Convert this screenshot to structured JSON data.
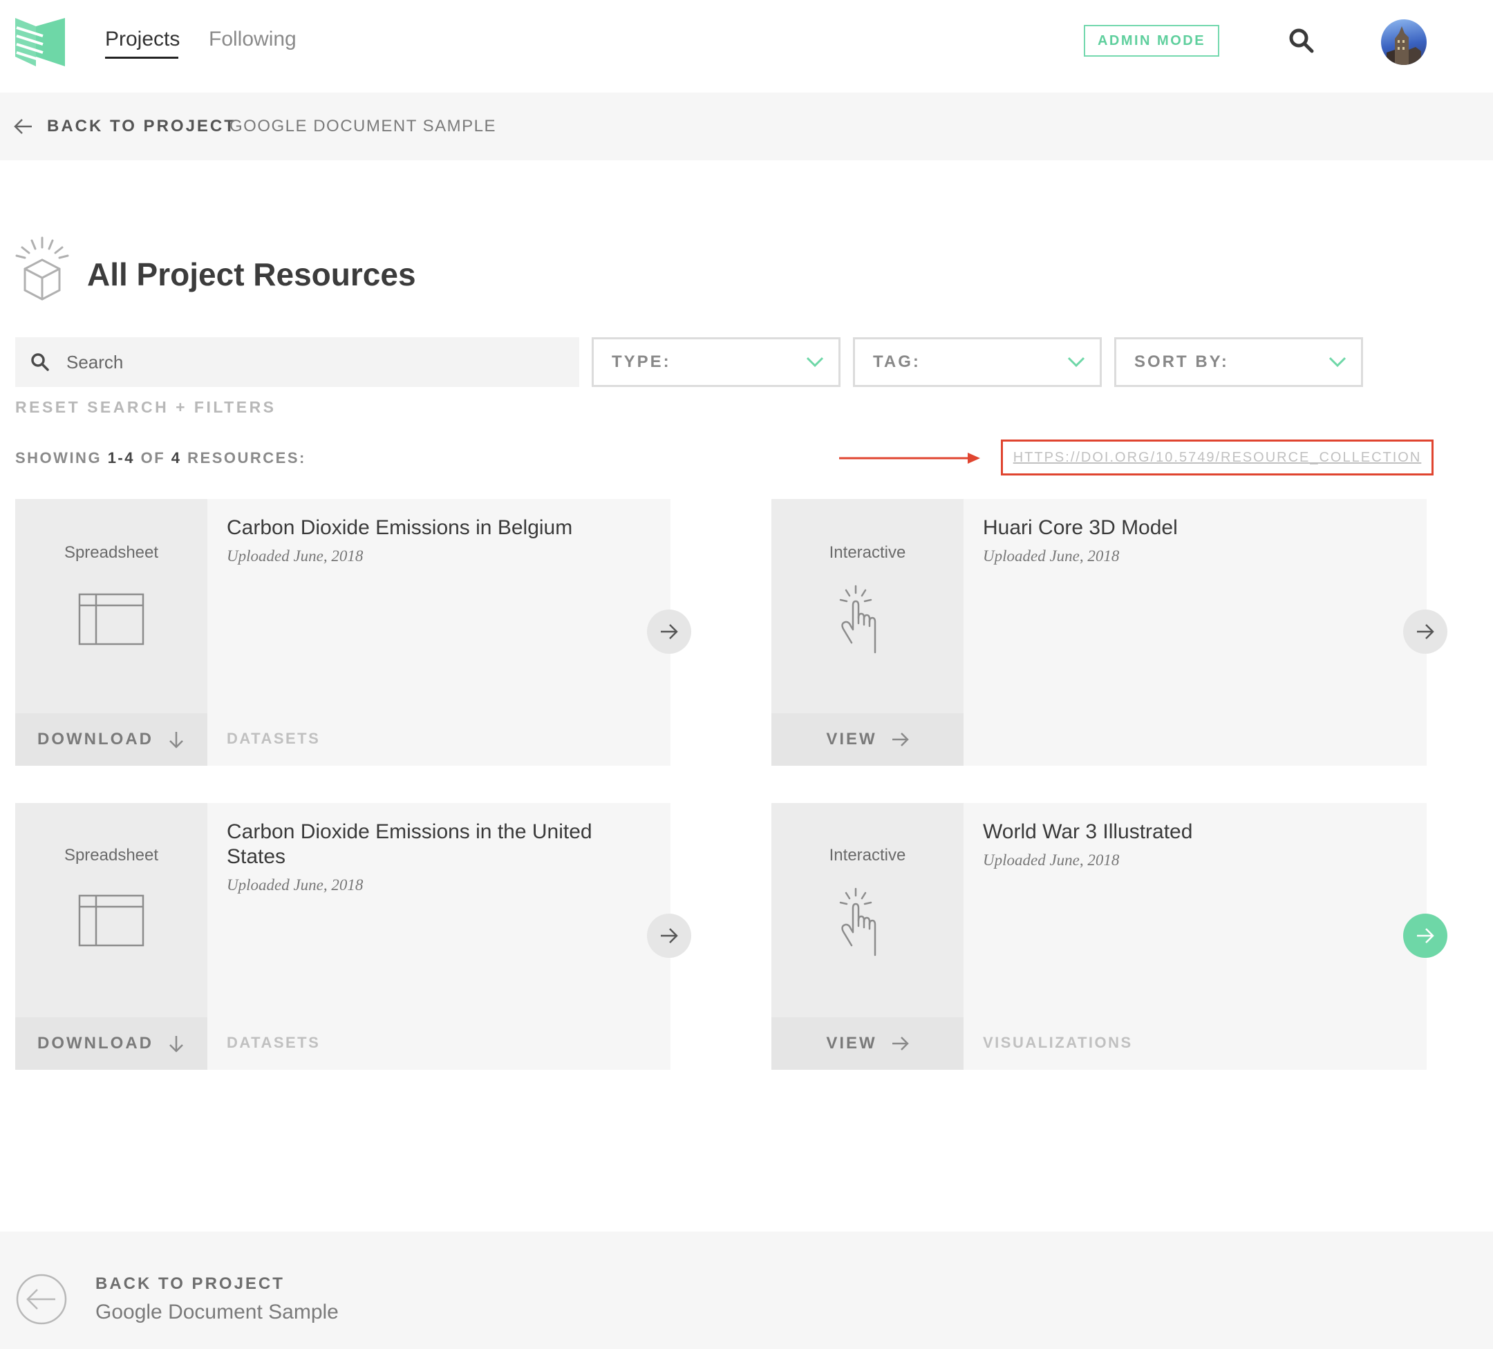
{
  "nav": {
    "tabs": [
      {
        "label": "Projects",
        "active": true
      },
      {
        "label": "Following",
        "active": false
      }
    ],
    "admin_label": "ADMIN MODE",
    "search_icon": "search-icon"
  },
  "breadcrumb": {
    "back_label": "BACK TO PROJECT",
    "project": "GOOGLE DOCUMENT SAMPLE"
  },
  "page": {
    "title": "All Project Resources"
  },
  "filters": {
    "search_placeholder": "Search",
    "type_label": "TYPE:",
    "tag_label": "TAG:",
    "sort_label": "SORT BY:",
    "reset_label": "RESET SEARCH + FILTERS"
  },
  "results": {
    "prefix": "SHOWING",
    "range": "1-4",
    "of": "OF",
    "total": "4",
    "suffix": "RESOURCES:",
    "doi": "HTTPS://DOI.ORG/10.5749/RESOURCE_COLLECTION"
  },
  "resources": [
    {
      "type": "Spreadsheet",
      "icon": "spreadsheet-icon",
      "action": "DOWNLOAD",
      "action_icon": "arrow-down-icon",
      "title": "Carbon Dioxide Emissions in Belgium",
      "date": "Uploaded June, 2018",
      "tag": "DATASETS",
      "highlighted": false
    },
    {
      "type": "Interactive",
      "icon": "hand-pointer-icon",
      "action": "VIEW",
      "action_icon": "arrow-right-icon",
      "title": "Huari Core 3D Model",
      "date": "Uploaded June, 2018",
      "tag": "",
      "highlighted": false
    },
    {
      "type": "Spreadsheet",
      "icon": "spreadsheet-icon",
      "action": "DOWNLOAD",
      "action_icon": "arrow-down-icon",
      "title": "Carbon Dioxide Emissions in the United States",
      "date": "Uploaded June, 2018",
      "tag": "DATASETS",
      "highlighted": false
    },
    {
      "type": "Interactive",
      "icon": "hand-pointer-icon",
      "action": "VIEW",
      "action_icon": "arrow-right-icon",
      "title": "World War 3 Illustrated",
      "date": "Uploaded June, 2018",
      "tag": "VISUALIZATIONS",
      "highlighted": true
    }
  ],
  "footer": {
    "back_label": "BACK TO PROJECT",
    "project": "Google Document Sample"
  },
  "colors": {
    "accent": "#6ed7a7",
    "annotation": "#e04530"
  }
}
